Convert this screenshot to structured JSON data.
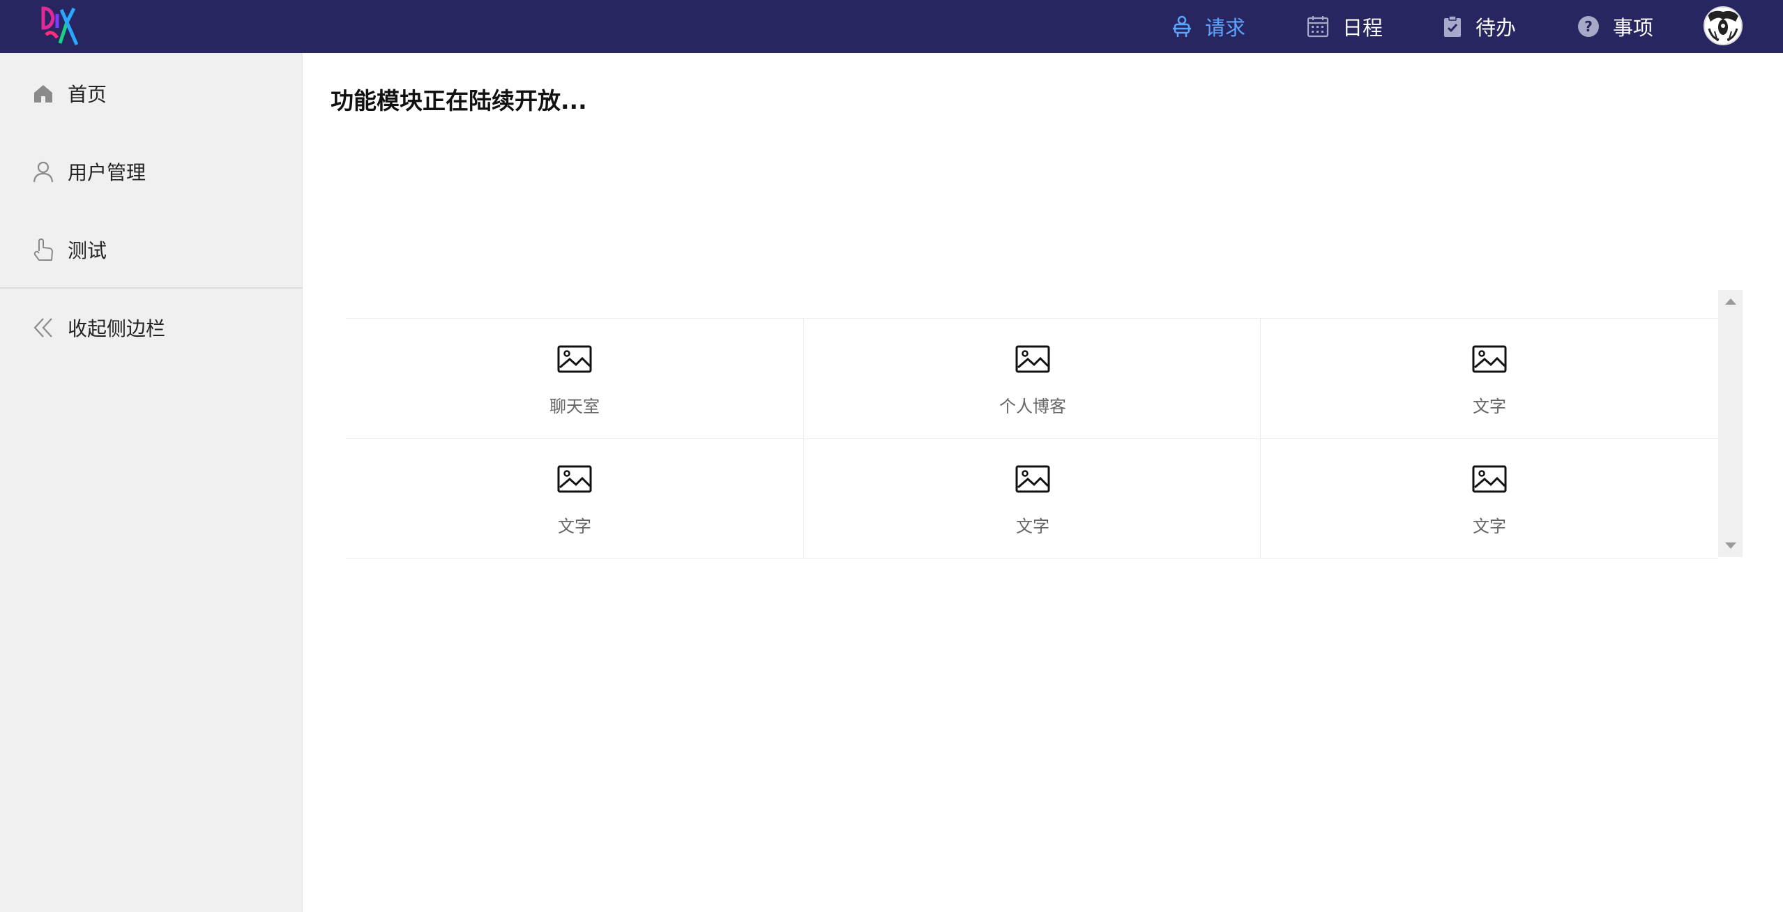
{
  "header": {
    "logo_text": "DIY",
    "nav": [
      {
        "label": "请求",
        "icon": "request-icon",
        "active": true
      },
      {
        "label": "日程",
        "icon": "calendar-icon",
        "active": false
      },
      {
        "label": "待办",
        "icon": "clipboard-check-icon",
        "active": false
      },
      {
        "label": "事项",
        "icon": "question-circle-icon",
        "active": false
      }
    ],
    "avatar_icon": "avatar-icon"
  },
  "sidebar": {
    "items": [
      {
        "label": "首页",
        "icon": "home-icon"
      },
      {
        "label": "用户管理",
        "icon": "user-icon"
      },
      {
        "label": "测试",
        "icon": "pointer-hand-icon"
      },
      {
        "label": "收起侧边栏",
        "icon": "double-chevron-left-icon"
      }
    ]
  },
  "main": {
    "title": "功能模块正在陆续开放...",
    "modules": [
      {
        "label": "聊天室",
        "icon": "image-icon"
      },
      {
        "label": "个人博客",
        "icon": "image-icon"
      },
      {
        "label": "文字",
        "icon": "image-icon"
      },
      {
        "label": "文字",
        "icon": "image-icon"
      },
      {
        "label": "文字",
        "icon": "image-icon"
      },
      {
        "label": "文字",
        "icon": "image-icon"
      }
    ]
  },
  "colors": {
    "header_bg": "#272660",
    "active_nav": "#5aa6ff",
    "sidebar_bg": "#f0f0f0"
  }
}
